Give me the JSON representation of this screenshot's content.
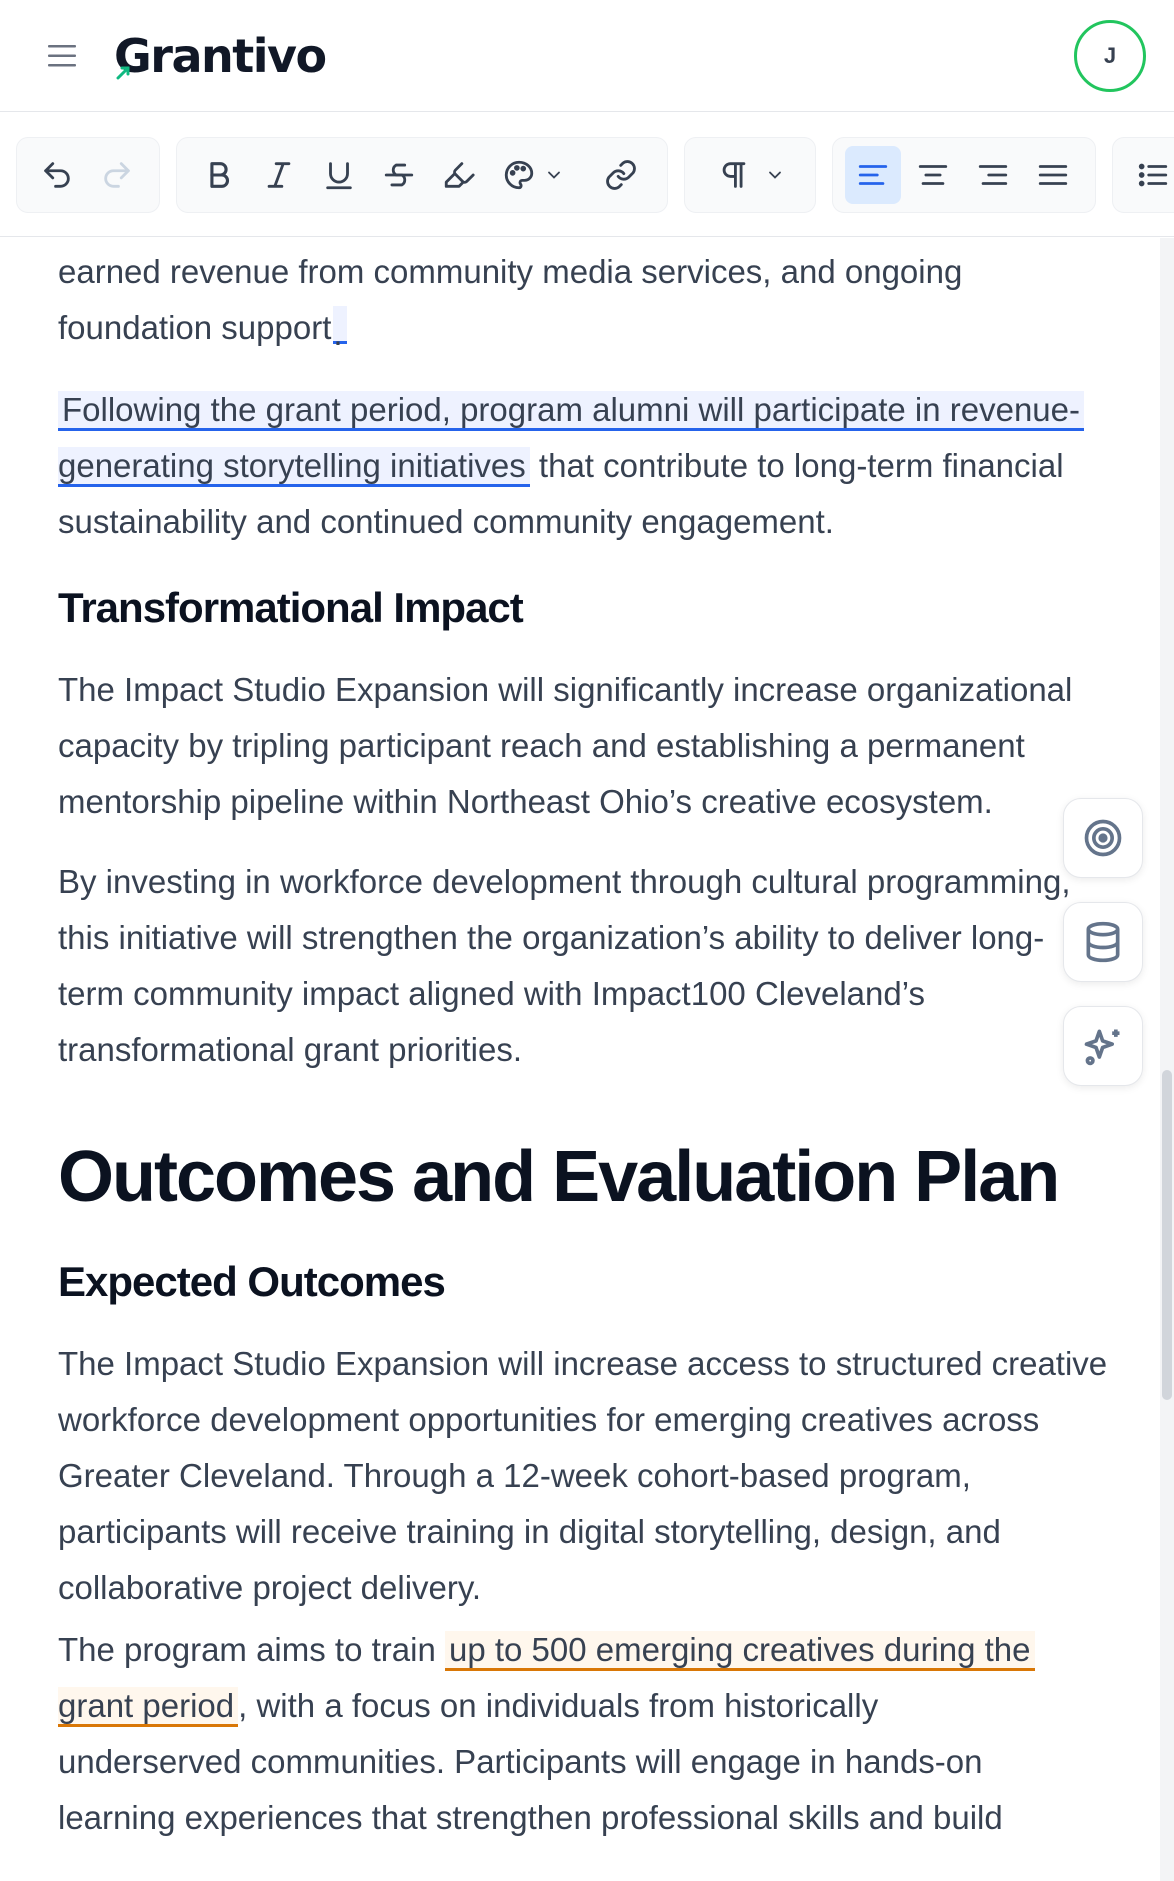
{
  "header": {
    "app_name": "Grantivo",
    "avatar_initial": "J"
  },
  "toolbar": {
    "buttons": [
      "undo-icon",
      "redo-icon",
      "bold-icon",
      "italic-icon",
      "underline-icon",
      "strikethrough-icon",
      "highlighter-icon",
      "palette-icon",
      "chevron-down-icon",
      "link-icon",
      "pilcrow-icon",
      "chevron-down-icon",
      "align-left-icon",
      "align-center-icon",
      "align-right-icon",
      "align-justify-icon",
      "list-icon"
    ],
    "active": "align-left"
  },
  "document": {
    "para1_line1": "earned revenue from community media services, and ongoing",
    "para1_line2": "foundation support",
    "para1_end": ".",
    "para2_highlight_1": "Following the grant period, program alumni will participate in revenue-",
    "para2_highlight_2": "generating storytelling initiatives",
    "para2_rest_line2": " that contribute to long-term financial",
    "para2_line3": "sustainability and continued community engagement.",
    "heading_transformational": "Transformational Impact",
    "para3": "The Impact Studio Expansion will significantly increase organizational capacity by tripling participant reach and establishing a permanent mentorship pipeline within Northeast Ohio’s creative ecosystem.",
    "para4": "By investing in workforce development through cultural programming, this initiative will strengthen the organization’s ability to deliver long-term community impact aligned with Impact100 Cleveland’s transformational grant priorities.",
    "heading_outcomes": "Outcomes and Evaluation Plan",
    "heading_expected": "Expected Outcomes",
    "para5": "The Impact Studio Expansion will increase access to structured creative workforce development opportunities for emerging creatives across Greater Cleveland. Through a 12-week cohort-based program, participants will receive training in digital storytelling, design, and collaborative project delivery.",
    "para6_start": "The program aims to train ",
    "para6_highlight_1": "up to 500 emerging creatives during the",
    "para6_highlight_2": "grant period",
    "para6_line2_rest": ", with a focus on individuals from historically",
    "para6_line3": "underserved communities. Participants will engage in hands-on",
    "para6_line4": "learning experiences that strengthen professional skills and build"
  },
  "fabs": [
    "target-icon",
    "database-icon",
    "sparkles-icon"
  ],
  "colors": {
    "accent": "#2563eb",
    "highlight_orange": "#d97706",
    "avatar_ring": "#22c55e",
    "logo_arrow": "#10b981"
  }
}
